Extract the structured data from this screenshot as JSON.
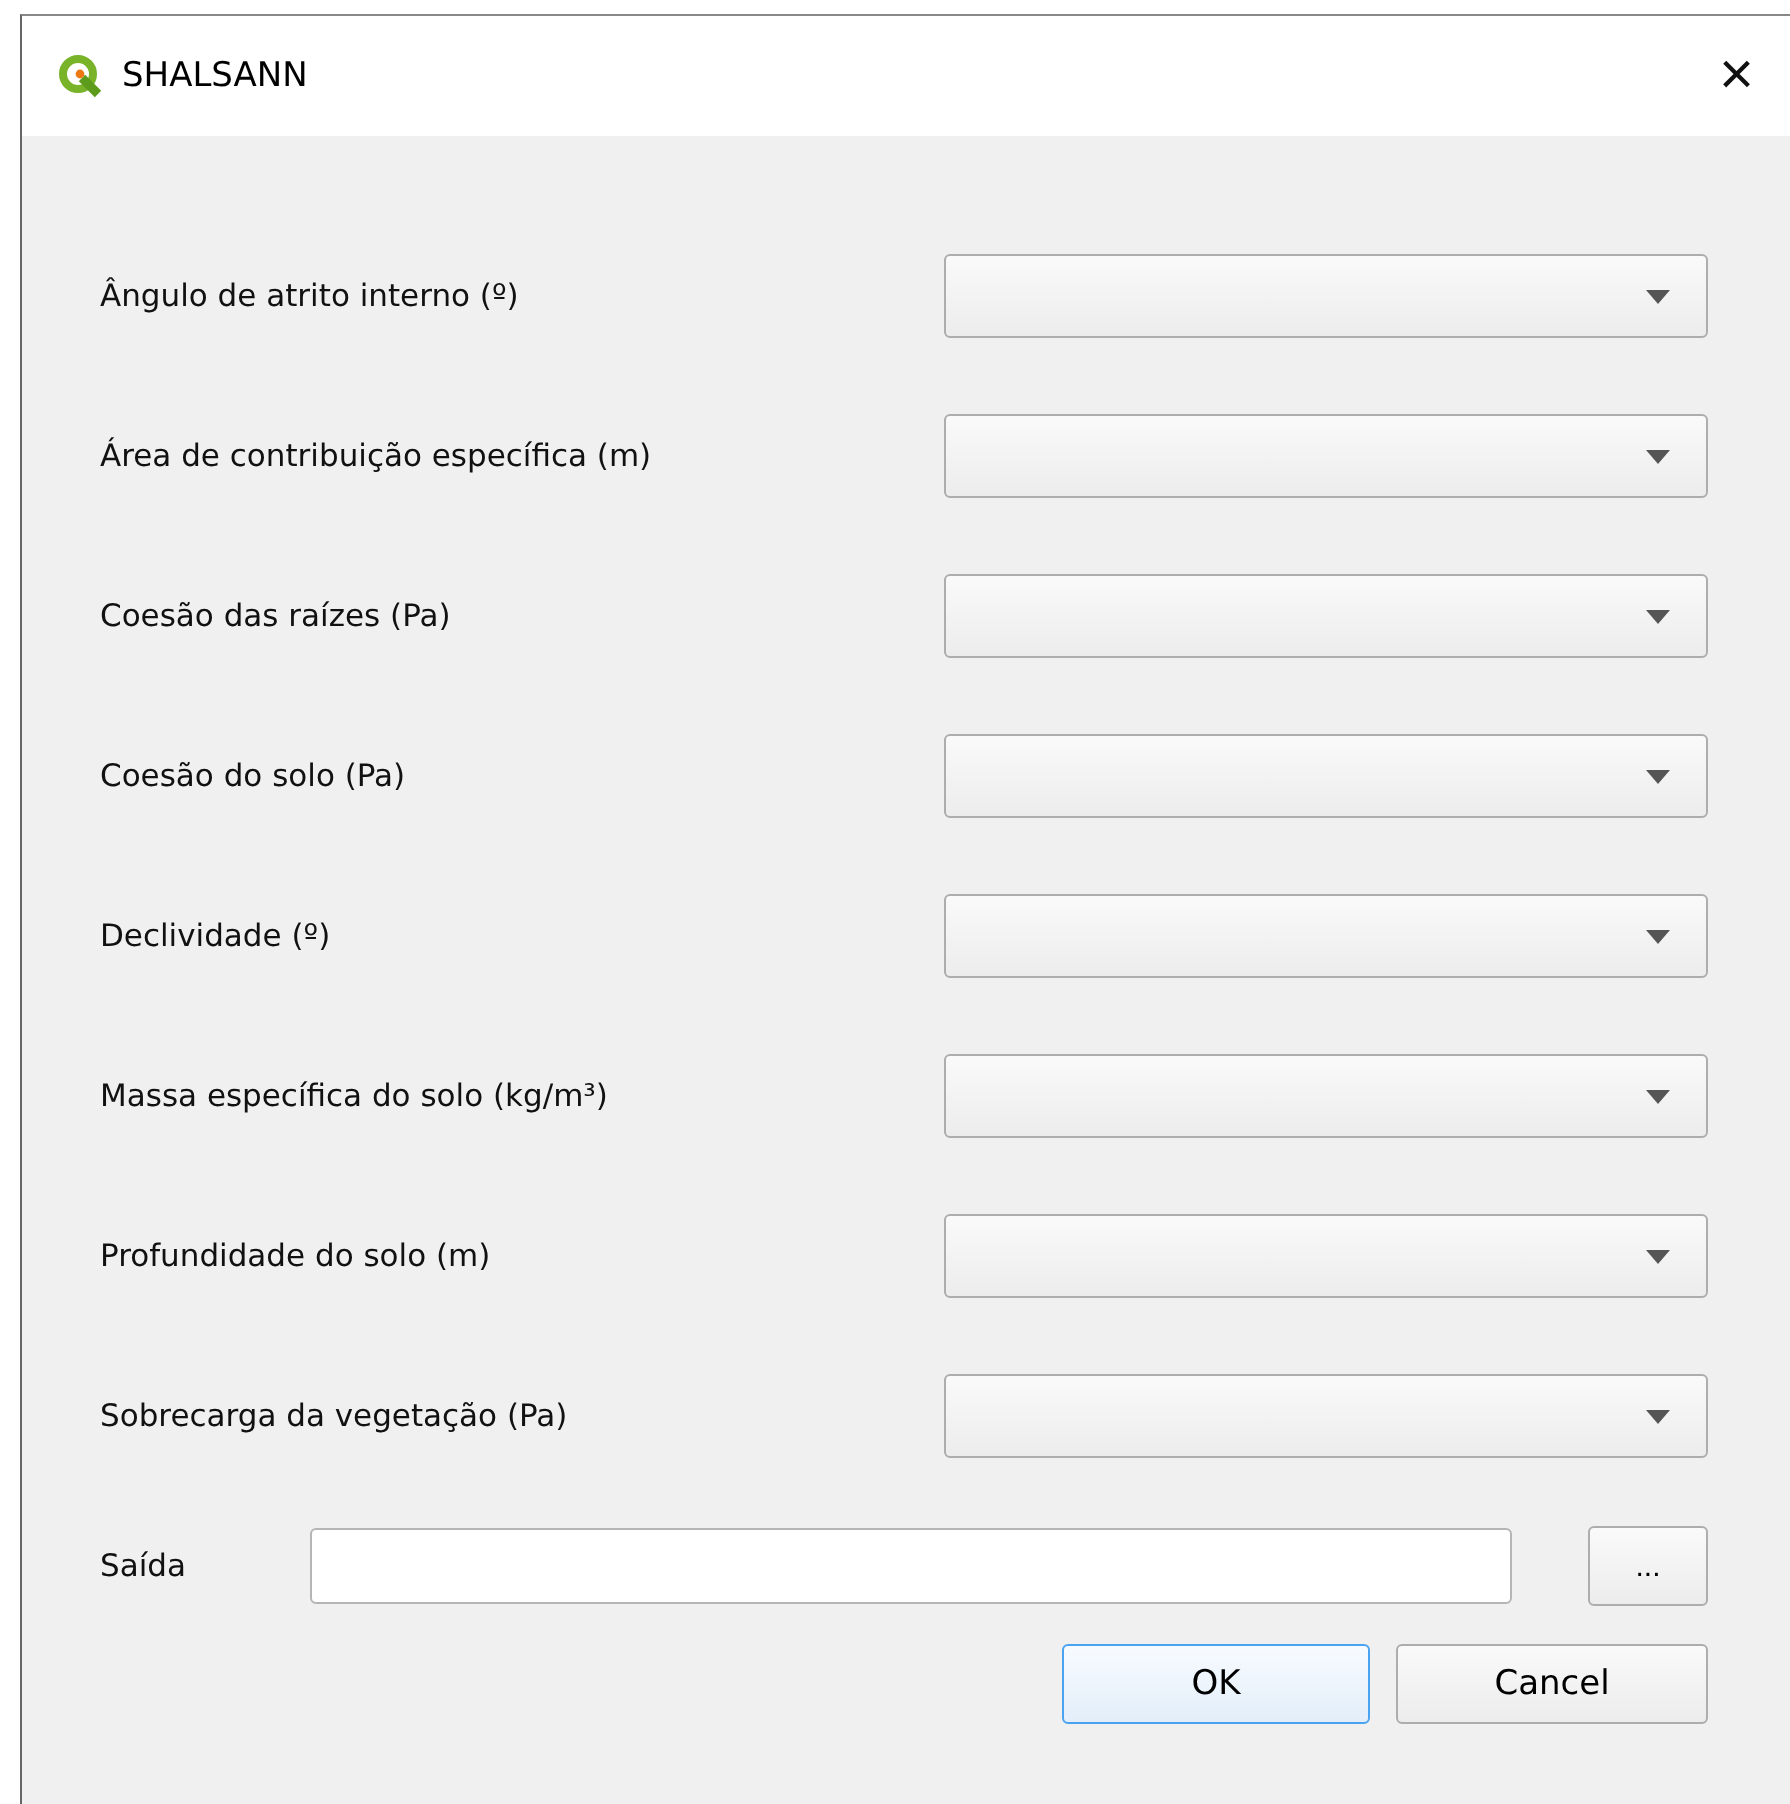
{
  "window": {
    "title": "SHALSANN",
    "close": "×"
  },
  "fields": [
    {
      "label": "Ângulo de atrito interno (º)"
    },
    {
      "label": "Área de contribuição específica (m)"
    },
    {
      "label": "Coesão das raízes (Pa)"
    },
    {
      "label": "Coesão do solo (Pa)"
    },
    {
      "label": "Declividade (º)"
    },
    {
      "label": "Massa específica do solo (kg/m³)"
    },
    {
      "label": "Profundidade do solo (m)"
    },
    {
      "label": "Sobrecarga da vegetação (Pa)"
    }
  ],
  "output": {
    "label": "Saída",
    "browse": "..."
  },
  "buttons": [
    {
      "label": "OK",
      "focused": true
    },
    {
      "label": "Cancel",
      "focused": false
    }
  ]
}
